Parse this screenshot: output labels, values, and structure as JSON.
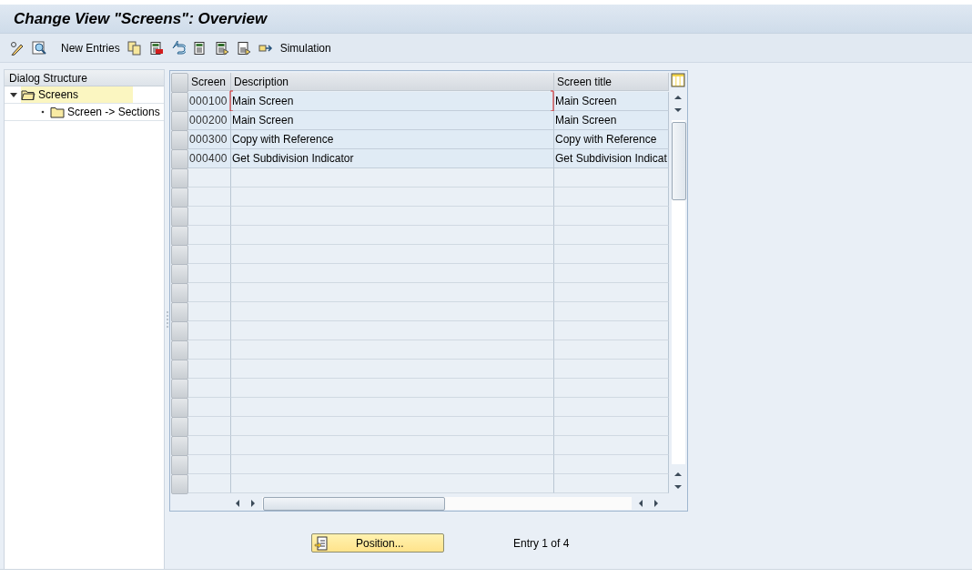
{
  "window": {
    "title": "Change View \"Screens\": Overview"
  },
  "toolbar": {
    "new_entries": "New Entries",
    "simulation": "Simulation"
  },
  "dialog_structure": {
    "title": "Dialog Structure",
    "items": [
      {
        "label": "Screens",
        "expanded": true,
        "selected": true,
        "children": [
          {
            "label": "Screen -> Sections",
            "selected": false
          }
        ]
      }
    ]
  },
  "table": {
    "columns": [
      "Screen",
      "Description",
      "Screen title"
    ],
    "rows": [
      {
        "screen": "000100",
        "description": "Main Screen",
        "title": "Main Screen",
        "focused": true
      },
      {
        "screen": "000200",
        "description": "Main Screen",
        "title": "Main Screen",
        "focused": false
      },
      {
        "screen": "000300",
        "description": "Copy with Reference",
        "title": "Copy with Reference",
        "focused": false
      },
      {
        "screen": "000400",
        "description": "Get Subdivision Indicator",
        "title": "Get Subdivision Indicat",
        "focused": false
      }
    ]
  },
  "footer": {
    "position_button": "Position...",
    "entry": "Entry 1 of 4"
  }
}
